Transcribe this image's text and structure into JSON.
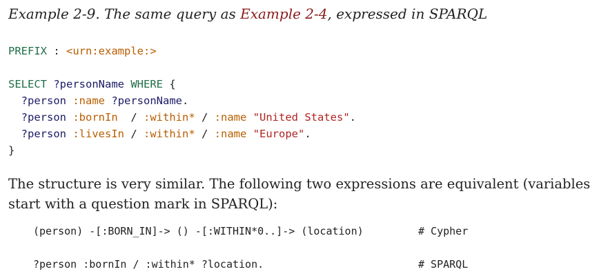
{
  "caption": {
    "prefix": "Example 2-9. The same query as ",
    "link": "Example 2-4",
    "suffix": ", expressed in SPARQL"
  },
  "code": {
    "prefix_kw": "PREFIX",
    "prefix_rest": " : ",
    "prefix_uri": "<urn:example:>",
    "select_kw": "SELECT",
    "select_var": "?personName",
    "where_kw": "WHERE",
    "open_brace": "{",
    "l1_subj": "?person",
    "l1_pred": ":name",
    "l1_obj": "?personName",
    "l2_subj": "?person",
    "l2_pred1": ":bornIn",
    "l2_pred2": ":within*",
    "l2_pred3": ":name",
    "l2_str": "\"United States\"",
    "l3_subj": "?person",
    "l3_pred1": ":livesIn",
    "l3_pred2": ":within*",
    "l3_pred3": ":name",
    "l3_str": "\"Europe\"",
    "close_brace": "}"
  },
  "paragraph": "The structure is very similar. The following two expressions are equivalent (variables start with a question mark in SPARQL):",
  "equivalents": {
    "cypher_expr": "(person) -[:BORN_IN]-> () -[:WITHIN*0..]-> (location)",
    "cypher_comment": "# Cypher",
    "sparql_expr": "?person :bornIn / :within* ?location.",
    "sparql_comment": "# SPARQL"
  }
}
